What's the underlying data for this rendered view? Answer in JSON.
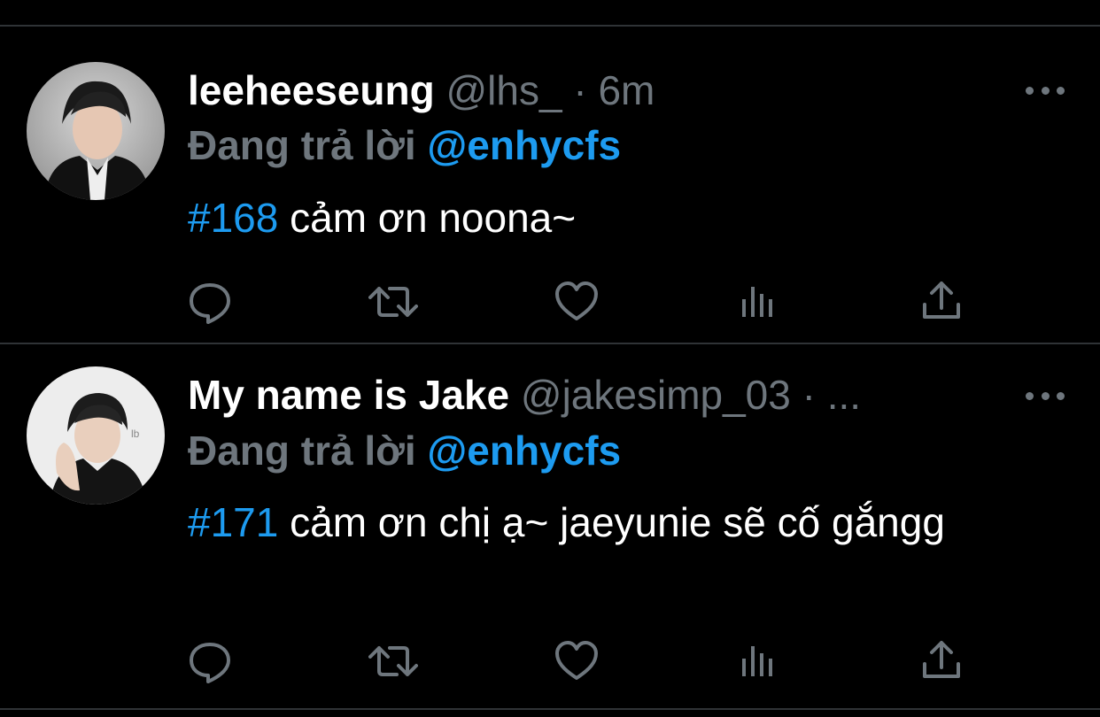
{
  "colors": {
    "background": "#000000",
    "divider": "#2f3336",
    "muted": "#6e767d",
    "accent": "#1d9bf0",
    "text": "#ffffff"
  },
  "tweets": [
    {
      "display_name": "leeheeseung",
      "handle": "@lhs_",
      "separator": "·",
      "time": "6m",
      "reply_prefix": "Đang trả lời",
      "reply_to": "@enhycfs",
      "hashtag": "#168",
      "text": " cảm ơn noona~",
      "avatar_icon": "profile-photo"
    },
    {
      "display_name": "My name is Jake",
      "handle": "@jakesimp_03",
      "separator": "·",
      "time": "...",
      "reply_prefix": "Đang trả lời",
      "reply_to": "@enhycfs",
      "hashtag": "#171",
      "text": " cảm ơn chị ạ~ jaeyunie sẽ cố gắngg",
      "avatar_icon": "profile-photo"
    }
  ],
  "action_icons": [
    "reply-icon",
    "retweet-icon",
    "like-icon",
    "analytics-icon",
    "share-icon"
  ],
  "more_icon": "more-options-icon"
}
